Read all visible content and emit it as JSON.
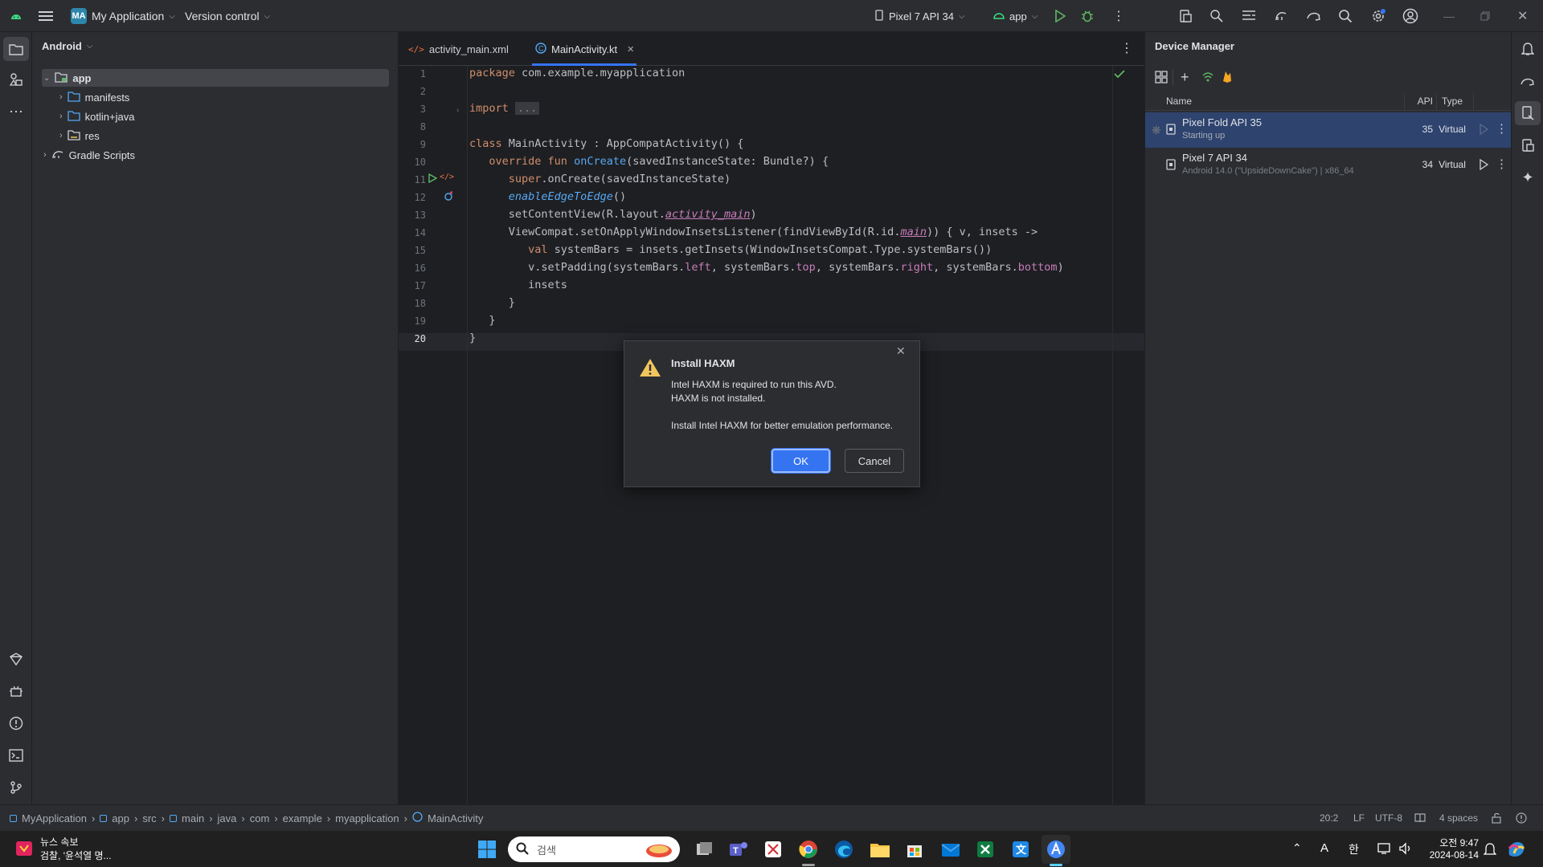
{
  "titlebar": {
    "project_badge": "MA",
    "project_name": "My Application",
    "vcs": "Version control",
    "device": "Pixel 7 API 34",
    "run_config": "app"
  },
  "project_panel": {
    "view_mode": "Android",
    "items": [
      {
        "label": "app"
      },
      {
        "label": "manifests"
      },
      {
        "label": "kotlin+java"
      },
      {
        "label": "res"
      },
      {
        "label": "Gradle Scripts"
      }
    ]
  },
  "editor": {
    "tabs": [
      {
        "label": "activity_main.xml"
      },
      {
        "label": "MainActivity.kt"
      }
    ],
    "line_numbers": [
      "1",
      "2",
      "3",
      "8",
      "9",
      "10",
      "11",
      "12",
      "13",
      "14",
      "15",
      "16",
      "17",
      "18",
      "19",
      "20"
    ],
    "code": {
      "l1_kw": "package",
      "l1_rest": " com.example.myapplication",
      "l3_kw": "import",
      "l3_fold": "...",
      "l9_kw": "class",
      "l9_rest": " MainActivity : AppCompatActivity() {",
      "l10_kw": "override fun",
      "l10_fn": "onCreate",
      "l10_rest": "(savedInstanceState: Bundle?) {",
      "l11_kw": "super",
      "l11_rest": ".onCreate(savedInstanceState)",
      "l12_it": "enableEdgeToEdge",
      "l12_rest": "()",
      "l13_a": "setContentView(R.layout.",
      "l13_b": "activity_main",
      "l13_c": ")",
      "l14_a": "ViewCompat.setOnApplyWindowInsetsListener(findViewById(R.id.",
      "l14_b": "main",
      "l14_c": ")) { v, insets ->",
      "l15_kw": "val",
      "l15_rest": " systemBars = insets.getInsets(WindowInsetsCompat.Type.systemBars())",
      "l16_a": "v.setPadding(systemBars.",
      "l16_left": "left",
      "l16_b": ", systemBars.",
      "l16_top": "top",
      "l16_c": ", systemBars.",
      "l16_right": "right",
      "l16_d": ", systemBars.",
      "l16_bottom": "bottom",
      "l16_e": ")",
      "l17": "insets",
      "l18": "}",
      "l19": "}",
      "l20": "}"
    }
  },
  "device_manager": {
    "title": "Device Manager",
    "columns": {
      "name": "Name",
      "api": "API",
      "type": "Type"
    },
    "devices": [
      {
        "name": "Pixel Fold API 35",
        "status": "Starting up",
        "api": "35",
        "type": "Virtual"
      },
      {
        "name": "Pixel 7 API 34",
        "status": "Android 14.0 (\"UpsideDownCake\") | x86_64",
        "api": "34",
        "type": "Virtual"
      }
    ]
  },
  "dialog": {
    "title": "Install HAXM",
    "line1": "Intel HAXM is required to run this AVD.",
    "line2": "HAXM is not installed.",
    "line3": "Install Intel HAXM for better emulation performance.",
    "ok": "OK",
    "cancel": "Cancel"
  },
  "statusbar": {
    "breadcrumbs": [
      "MyApplication",
      "app",
      "src",
      "main",
      "java",
      "com",
      "example",
      "myapplication",
      "MainActivity"
    ],
    "position": "20:2",
    "line_sep": "LF",
    "encoding": "UTF-8",
    "indent": "4 spaces"
  },
  "taskbar": {
    "news_title": "뉴스 속보",
    "news_sub": "검찰, '윤석열 명...",
    "search_placeholder": "검색",
    "ime_a": "A",
    "ime_ko": "한",
    "time": "오전 9:47",
    "date": "2024-08-14"
  },
  "colors": {
    "accent": "#3574f0",
    "selection": "#2e436e",
    "warning": "#f2c55c"
  }
}
